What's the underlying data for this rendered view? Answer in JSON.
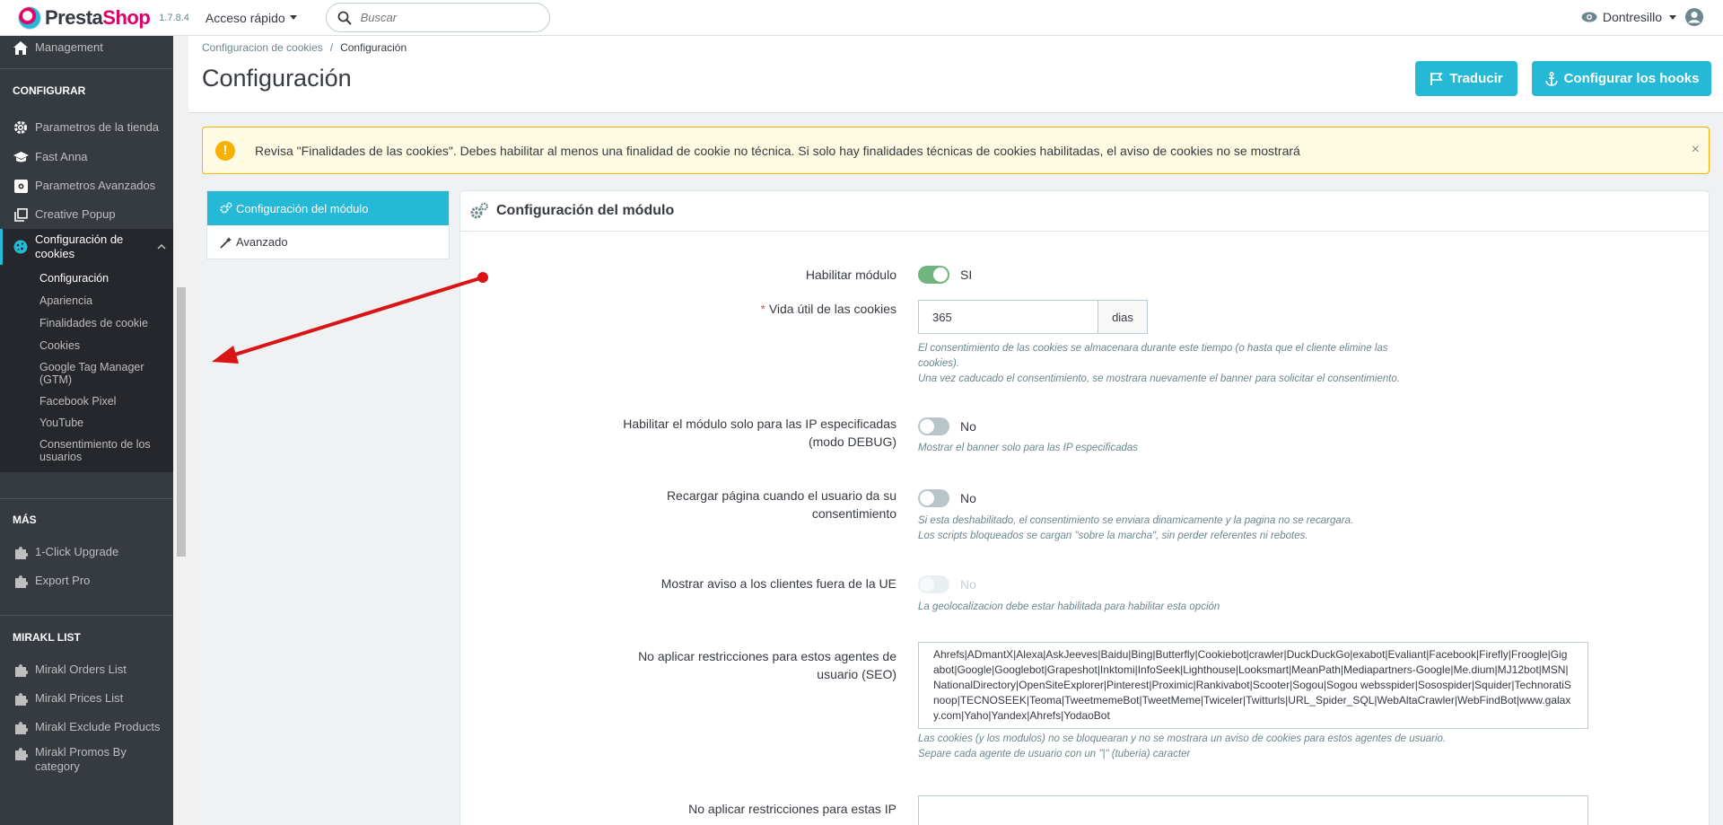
{
  "header": {
    "logo_part1": "Presta",
    "logo_part2": "Shop",
    "version": "1.7.8.4",
    "quick_access": "Acceso rápido",
    "search_placeholder": "Buscar",
    "username": "Dontresillo"
  },
  "sidebar": {
    "top_item": "Management",
    "sections": [
      {
        "title": "CONFIGURAR",
        "items": [
          {
            "label": "Parametros de la tienda",
            "icon": "gear-icon"
          },
          {
            "label": "Fast Anna",
            "icon": "graduation-cap-icon"
          },
          {
            "label": "Parametros Avanzados",
            "icon": "settings-box-icon"
          },
          {
            "label": "Creative Popup",
            "icon": "layers-icon"
          },
          {
            "label": "Configuración de cookies",
            "icon": "cookie-icon"
          }
        ],
        "submenu": [
          "Configuración",
          "Apariencia",
          "Finalidades de cookie",
          "Cookies",
          "Google Tag Manager (GTM)",
          "Facebook Pixel",
          "YouTube",
          "Consentimiento de los usuarios"
        ]
      },
      {
        "title": "MÁS",
        "items": [
          {
            "label": "1-Click Upgrade",
            "icon": "puzzle-icon"
          },
          {
            "label": "Export Pro",
            "icon": "puzzle-icon"
          }
        ]
      },
      {
        "title": "MIRAKL LIST",
        "items": [
          {
            "label": "Mirakl Orders List",
            "icon": "puzzle-icon"
          },
          {
            "label": "Mirakl Prices List",
            "icon": "puzzle-icon"
          },
          {
            "label": "Mirakl Exclude Products",
            "icon": "puzzle-icon"
          },
          {
            "label": "Mirakl Promos By category",
            "icon": "puzzle-icon"
          }
        ]
      }
    ]
  },
  "page": {
    "breadcrumb": [
      "Configuracion de cookies",
      "Configuración"
    ],
    "title": "Configuración",
    "btn_translate": "Traducir",
    "btn_hooks": "Configurar los hooks"
  },
  "alert": {
    "text": "Revisa \"Finalidades de las cookies\". Debes habilitar al menos una finalidad de cookie no técnica. Si solo hay finalidades técnicas de cookies habilitadas, el aviso de cookies no se mostrará",
    "close": "×"
  },
  "tabs": [
    "Configuración del módulo",
    "Avanzado"
  ],
  "panel": {
    "title": "Configuración del módulo",
    "fields": {
      "enable": {
        "label": "Habilitar módulo",
        "state": "SI"
      },
      "lifetime": {
        "required": "*",
        "label": "Vida útil de las cookies",
        "value": "365",
        "unit": "dias",
        "help1": "El consentimiento de las cookies se almacenara durante este tiempo (o hasta que el cliente elimine las cookies).",
        "help2": "Una vez caducado el consentimiento, se mostrara nuevamente el banner para solicitar el consentimiento."
      },
      "debug": {
        "label": "Habilitar el módulo solo para las IP especificadas (modo DEBUG)",
        "state": "No",
        "help": "Mostrar el banner solo para las IP especificadas"
      },
      "reload": {
        "label": "Recargar página cuando el usuario da su consentimiento",
        "state": "No",
        "help1": "Si esta deshabilitado, el consentimiento se enviara dinamicamente y la pagina no se recargara.",
        "help2": "Los scripts bloqueados se cargan \"sobre la marcha\", sin perder referentes ni rebotes."
      },
      "outside_eu": {
        "label": "Mostrar aviso a los clientes fuera de la UE",
        "state": "No",
        "help": "La geolocalizacion debe estar habilitada para habilitar esta opción"
      },
      "user_agents": {
        "label": "No aplicar restricciones para estos agentes de usuario (SEO)",
        "value": "Ahrefs|ADmantX|Alexa|AskJeeves|Baidu|Bing|Butterfly|Cookiebot|crawler|DuckDuckGo|exabot|Evaliant|Facebook|Firefly|Froogle|Gigabot|Google|Googlebot|Grapeshot|Inktomi|InfoSeek|Lighthouse|Looksmart|MeanPath|Mediapartners-Google|Me.dium|MJ12bot|MSN|NationalDirectory|OpenSiteExplorer|Pinterest|Proximic|Rankivabot|Scooter|Sogou|Sogou websspider|Sosospider|Squider|TechnoratiSnoop|TECNOSEEK|Teoma|TweetmemeBot|TweetMeme|Twiceler|Twitturls|URL_Spider_SQL|WebAltaCrawler|WebFindBot|www.galaxy.com|Yaho|Yandex|Ahrefs|YodaoBot",
        "help1": "Las cookies (y los modulos) no se bloquearan y no se mostrara un aviso de cookies para estos agentes de usuario.",
        "help2": "Separe cada agente de usuario con un \"|\" (tuberia) caracter"
      },
      "ips": {
        "label": "No aplicar restricciones para estas IP"
      }
    }
  }
}
